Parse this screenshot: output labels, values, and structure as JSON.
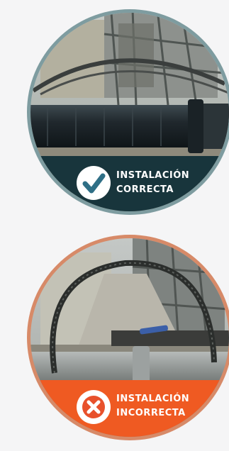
{
  "panels": [
    {
      "status": "correct",
      "line1": "INSTALACIÓN",
      "line2": "CORRECTA",
      "icon": "checkmark-icon",
      "ring_color": "#5f7f86",
      "band_color": "#18353c",
      "icon_color": "#2f6f86"
    },
    {
      "status": "incorrect",
      "line1": "INSTALACIÓN",
      "line2": "INCORRECTA",
      "icon": "cross-icon",
      "ring_color": "#d07a57",
      "band_color": "#ef5a22",
      "icon_color": "#e8512c"
    }
  ]
}
